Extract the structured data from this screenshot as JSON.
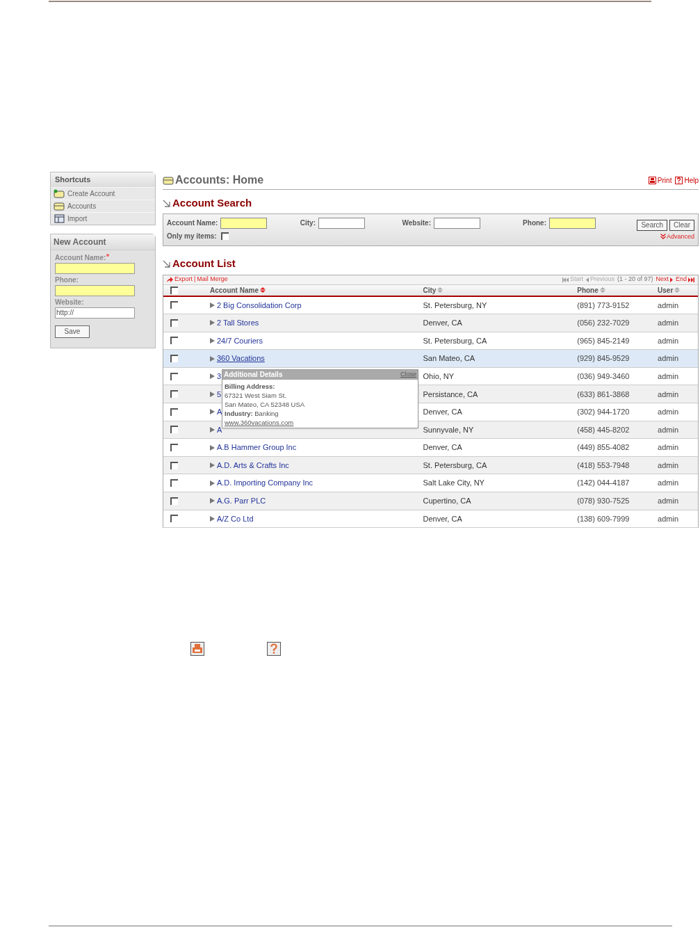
{
  "shortcuts": {
    "title": "Shortcuts",
    "items": [
      {
        "label": "Create Account",
        "kind": "create"
      },
      {
        "label": "Accounts",
        "kind": "folder"
      },
      {
        "label": "Import",
        "kind": "import"
      }
    ]
  },
  "new_account": {
    "title": "New Account",
    "fields": [
      {
        "label": "Account Name:",
        "required": true,
        "highlight": true
      },
      {
        "label": "Phone:",
        "required": false,
        "highlight": true
      },
      {
        "label": "Website:",
        "required": false,
        "value": "http://",
        "highlight": false
      }
    ],
    "save": "Save"
  },
  "page_title": "Accounts: Home",
  "print": "Print",
  "help": "Help",
  "search": {
    "title": "Account Search",
    "fields": [
      {
        "label": "Account Name:",
        "highlight": true
      },
      {
        "label": "City:",
        "highlight": false
      },
      {
        "label": "Website:",
        "highlight": false
      },
      {
        "label": "Phone:",
        "highlight": true
      }
    ],
    "only_mine": {
      "label": "Only my items:",
      "checked": false
    },
    "buttons": [
      "Search",
      "Clear"
    ],
    "advanced": "Advanced"
  },
  "list": {
    "title": "Account List",
    "export": "Export",
    "separator": "|",
    "mail_merge": "Mail Merge",
    "select_all": {
      "checked": false
    },
    "start": "Start",
    "previous": "Previous",
    "range": "(1 - 20 of 97)",
    "next": "Next",
    "end": "End",
    "columns": [
      "Account Name",
      "City",
      "Phone",
      "User"
    ],
    "rows": [
      {
        "name": "2 Big Consolidation Corp",
        "city": "St. Petersburg, NY",
        "phone": "(891) 773-9152",
        "user": "admin",
        "highlighted": false,
        "checked": false
      },
      {
        "name": "2 Tall Stores",
        "city": "Denver, CA",
        "phone": "(056) 232-7029",
        "user": "admin",
        "highlighted": false,
        "checked": false
      },
      {
        "name": "24/7 Couriers",
        "city": "St. Petersburg, CA",
        "phone": "(965) 845-2149",
        "user": "admin",
        "highlighted": false,
        "checked": false
      },
      {
        "name": "360 Vacations",
        "city": "San Mateo, CA",
        "phone": "(929) 845-9529",
        "user": "admin",
        "highlighted": true,
        "checked": false
      },
      {
        "name": "3",
        "city": "Ohio, NY",
        "phone": "(036) 949-3460",
        "user": "admin",
        "highlighted": false,
        "checked": false
      },
      {
        "name": "5",
        "city": "Persistance, CA",
        "phone": "(633) 861-3868",
        "user": "admin",
        "highlighted": false,
        "checked": false
      },
      {
        "name": "A",
        "city": "Denver, CA",
        "phone": "(302) 944-1720",
        "user": "admin",
        "highlighted": false,
        "checked": false
      },
      {
        "name": "A",
        "city": "Sunnyvale, NY",
        "phone": "(458) 445-8202",
        "user": "admin",
        "highlighted": false,
        "checked": false
      },
      {
        "name": "A.B Hammer Group Inc",
        "city": "Denver, CA",
        "phone": "(449) 855-4082",
        "user": "admin",
        "highlighted": false,
        "checked": false
      },
      {
        "name": "A.D. Arts & Crafts Inc",
        "city": "St. Petersburg, CA",
        "phone": "(418) 553-7948",
        "user": "admin",
        "highlighted": false,
        "checked": false
      },
      {
        "name": "A.D. Importing Company Inc",
        "city": "Salt Lake City, NY",
        "phone": "(142) 044-4187",
        "user": "admin",
        "highlighted": false,
        "checked": false
      },
      {
        "name": "A.G. Parr PLC",
        "city": "Cupertino, CA",
        "phone": "(078) 930-7525",
        "user": "admin",
        "highlighted": false,
        "checked": false
      },
      {
        "name": "A/Z Co Ltd",
        "city": "Denver, CA",
        "phone": "(138) 609-7999",
        "user": "admin",
        "highlighted": false,
        "checked": false
      }
    ]
  },
  "popup": {
    "title": "Additional Details",
    "close": "Close",
    "lines": [
      "**Billing Address:**",
      "67321 West Siam St.",
      "San Mateo, CA 52348 USA",
      "**Industry:** Banking"
    ],
    "link": "www.360vacations.com"
  }
}
